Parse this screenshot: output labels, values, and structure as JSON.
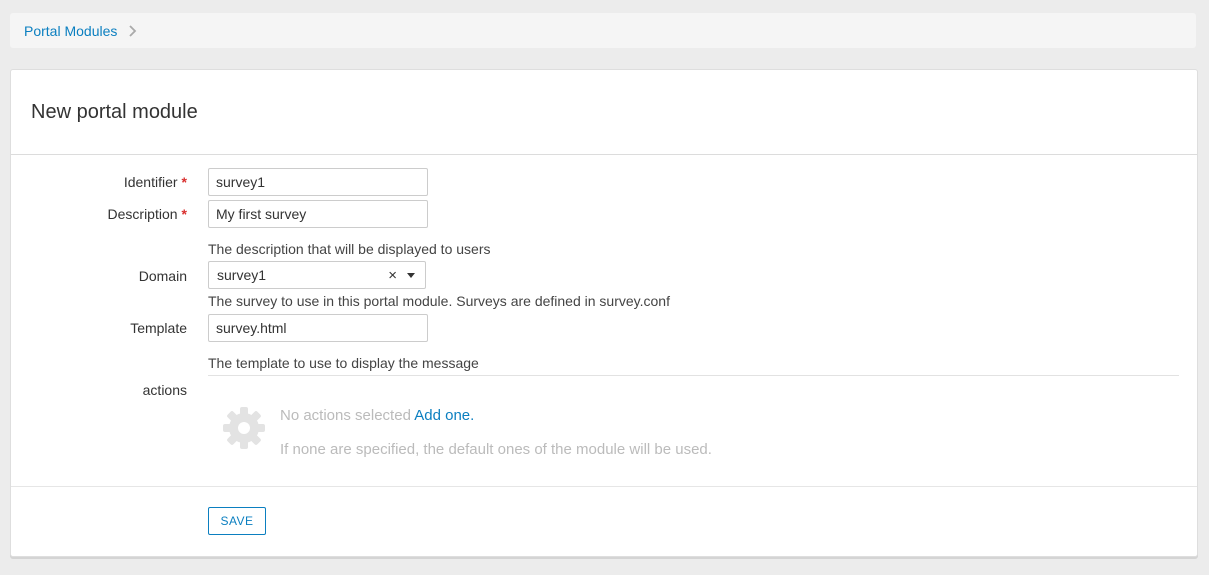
{
  "breadcrumb": {
    "item": "Portal Modules"
  },
  "form": {
    "title": "New portal module",
    "required_mark": "*",
    "identifier": {
      "label": "Identifier",
      "value": "survey1"
    },
    "description": {
      "label": "Description",
      "value": "My first survey",
      "help": "The description that will be displayed to users"
    },
    "domain": {
      "label": "Domain",
      "value": "survey1",
      "clear": "×",
      "help": "The survey to use in this portal module. Surveys are defined in survey.conf"
    },
    "template": {
      "label": "Template",
      "value": "survey.html",
      "help": "The template to use to display the message"
    },
    "actions": {
      "label": "actions",
      "empty": "No actions selected",
      "add_link": "Add one.",
      "hint": "If none are specified, the default ones of the module will be used."
    },
    "save_label": "SAVE"
  },
  "colors": {
    "accent": "#0b7fc0",
    "required": "#d9302f",
    "muted": "#bbbbbb"
  }
}
